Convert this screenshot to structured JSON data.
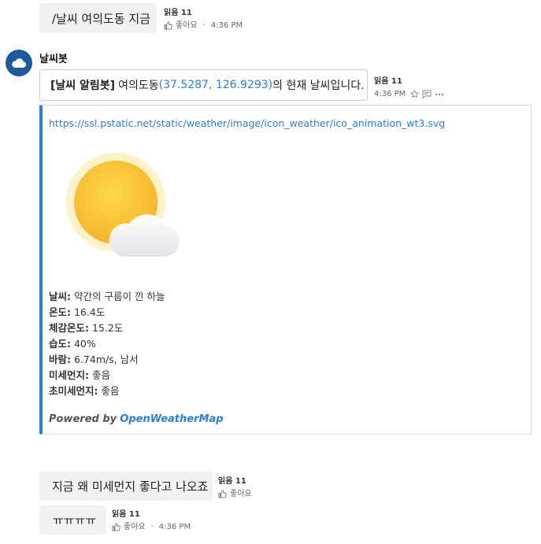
{
  "messages": [
    {
      "text": "/날씨 여의도동 지금",
      "read_label": "읽음 11",
      "like_label": "좋아요",
      "time": "4:36 PM"
    },
    {
      "text": "지금 왜 미세먼지 좋다고 나오죠",
      "read_label": "읽음 11",
      "like_label": "좋아요"
    },
    {
      "text": "ㅠㅠㅠㅠ",
      "read_label": "읽음 11",
      "like_label": "좋아요",
      "time": "4:36 PM"
    }
  ],
  "bot": {
    "name": "날씨봇",
    "avatar_icon": "cloud-icon",
    "message": {
      "title_bold": "[날씨 알림봇]",
      "location": "여의도동",
      "coords": "(37.5287, 126.9293)",
      "suffix": "의 현재 날씨입니다.",
      "read_label": "읽음 11",
      "time": "4:36 PM"
    },
    "attachment": {
      "url": "https://ssl.pstatic.net/static/weather/image/icon_weather/ico_animation_wt3.svg",
      "weather_icon": "sun-cloud-icon",
      "facts": [
        {
          "label": "날씨:",
          "value": "약간의 구름이 낀 하늘"
        },
        {
          "label": "온도:",
          "value": "16.4도"
        },
        {
          "label": "체감온도:",
          "value": "15.2도"
        },
        {
          "label": "습도:",
          "value": "40%"
        },
        {
          "label": "바람:",
          "value": "6.74m/s, 남서"
        },
        {
          "label": "미세먼지:",
          "value": "좋음"
        },
        {
          "label": "초미세먼지:",
          "value": "좋음"
        }
      ],
      "powered_prefix": "Powered by",
      "powered_link": "OpenWeatherMap"
    }
  },
  "colors": {
    "accent": "#2d7fd6",
    "avatar": "#1e5a9e"
  }
}
